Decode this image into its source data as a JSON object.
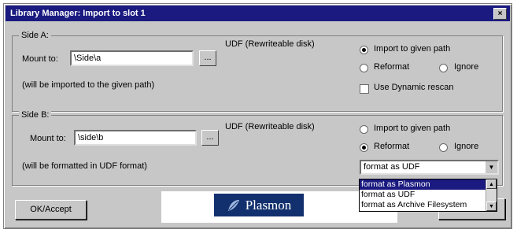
{
  "window": {
    "title": "Library Manager: Import to slot 1",
    "close_glyph": "×"
  },
  "side_a": {
    "legend": "Side A:",
    "mount_label": "Mount to:",
    "mount_value": "\\Side\\a",
    "browse_label": "...",
    "disk_type": "UDF (Rewriteable disk)",
    "note": "(will be imported to the given path)",
    "options": {
      "import_label": "Import to given path",
      "reformat_label": "Reformat",
      "ignore_label": "Ignore",
      "dynamic_label": "Use Dynamic rescan",
      "selected": "import",
      "dynamic_checked": false
    }
  },
  "side_b": {
    "legend": "Side B:",
    "mount_label": "Mount to:",
    "mount_value": "\\side\\b",
    "browse_label": "...",
    "disk_type": "UDF (Rewriteable disk)",
    "note": "(will be formatted in UDF format)",
    "options": {
      "import_label": "Import to given path",
      "reformat_label": "Reformat",
      "ignore_label": "Ignore",
      "selected": "reformat"
    },
    "format_select": {
      "value": "format as UDF",
      "options": [
        "format as Plasmon",
        "format as UDF",
        "format as Archive Filesystem"
      ],
      "highlighted": "format as Plasmon"
    }
  },
  "buttons": {
    "ok_label": "OK/Accept"
  },
  "logo": {
    "text": "Plasmon",
    "icon": "plasmon-leaf-icon",
    "brand_color": "#12306e"
  }
}
